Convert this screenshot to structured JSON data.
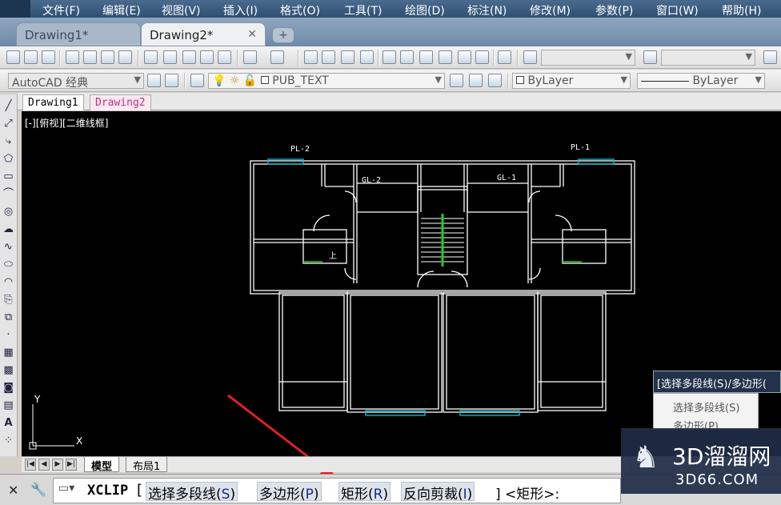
{
  "menu": [
    "文件(F)",
    "编辑(E)",
    "视图(V)",
    "插入(I)",
    "格式(O)",
    "工具(T)",
    "绘图(D)",
    "标注(N)",
    "修改(M)",
    "参数(P)",
    "窗口(W)",
    "帮助(H)"
  ],
  "doc_tabs": [
    {
      "label": "Drawing1*"
    },
    {
      "label": "Drawing2*",
      "close": "✕"
    }
  ],
  "toolbar2": {
    "workspace": "AutoCAD 经典",
    "layer": "PUB_TEXT",
    "color": "ByLayer",
    "linetype": "ByLayer"
  },
  "drawing_tabs": [
    "Drawing1",
    "Drawing2"
  ],
  "viewport_label": "[-][俯视][二维线框]",
  "plan_labels": {
    "pl2": "PL-2",
    "pl1": "PL-1",
    "gl2": "GL-2",
    "gl1": "GL-1",
    "up": "上"
  },
  "ucs": {
    "x": "X",
    "y": "Y"
  },
  "layout_tabs": [
    "模型",
    "布局1"
  ],
  "command": {
    "name": "XCLIP",
    "open_bracket": "[",
    "options": [
      {
        "text": "选择多段线(",
        "key": "S",
        "close": ")"
      },
      {
        "text": "多边形(",
        "key": "P",
        "close": ")"
      },
      {
        "text": "矩形(",
        "key": "R",
        "close": ")"
      },
      {
        "text": "反向剪裁(",
        "key": "I",
        "close": ")"
      }
    ],
    "tail": "] <矩形>:"
  },
  "popup": {
    "title": "[选择多段线(S)/多边形(",
    "items": [
      "选择多段线(S)",
      "多边形(P)"
    ]
  },
  "watermark": {
    "brand": "3D溜溜网",
    "url": "3D66.COM"
  },
  "colors": {
    "accent_arrow": "#e02020",
    "canvas": "#000000",
    "wall": "#ffffff",
    "window": "#00c8e0",
    "stair_green": "#22cc22"
  }
}
